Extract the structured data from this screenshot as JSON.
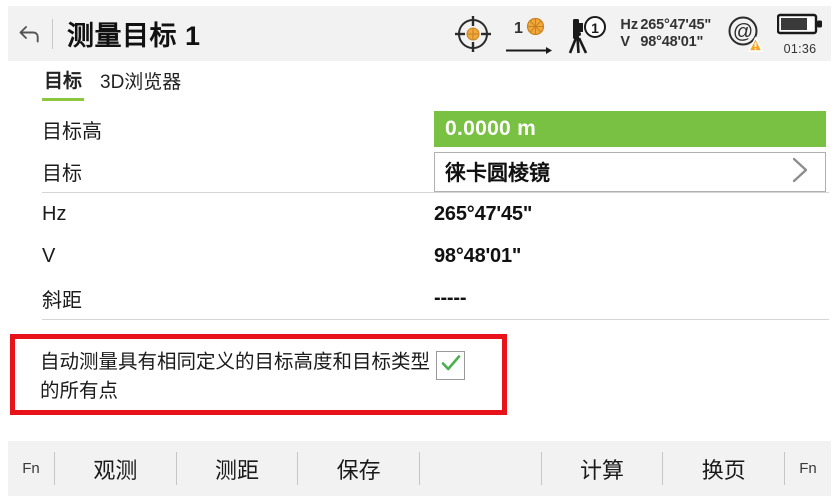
{
  "header": {
    "back_icon": "undo-arrow-icon",
    "title": "测量目标 1"
  },
  "status_bar": {
    "eyepiece_icon": "crosshair-target-icon",
    "prism_count": "1",
    "prism_icon": "prism-icon",
    "tripod_icon": "total-station-icon",
    "tripod_badge": "1",
    "hz_label": "Hz",
    "hz_value": "265°47'45\"",
    "v_label": "V",
    "v_value": "98°48'01\"",
    "connection_icon": "at-sign-warning-icon",
    "battery_icon": "battery-icon",
    "battery_level_percent": 72,
    "battery_time": "01:36"
  },
  "tabs": [
    {
      "label": "目标",
      "active": true
    },
    {
      "label": "3D浏览器",
      "active": false
    }
  ],
  "form": {
    "target_height": {
      "label": "目标高",
      "value": "0.0000 m",
      "field_color": "#79c143"
    },
    "target": {
      "label": "目标",
      "value": "徕卡圆棱镜",
      "chevron_icon": "chevron-right-icon"
    },
    "hz": {
      "label": "Hz",
      "value": "265°47'45\""
    },
    "v": {
      "label": "V",
      "value": "98°48'01\""
    },
    "slope_distance": {
      "label": "斜距",
      "value": "-----"
    }
  },
  "auto_measure": {
    "text": "自动测量具有相同定义的目标高度和目标类型的所有点",
    "checked": true,
    "check_icon": "checkmark-icon",
    "highlight_color": "#e8131a"
  },
  "toolbar": {
    "fn_left": "Fn",
    "buttons": [
      "观测",
      "测距",
      "保存"
    ],
    "buttons_right": [
      "计算",
      "换页"
    ],
    "fn_right": "Fn"
  }
}
